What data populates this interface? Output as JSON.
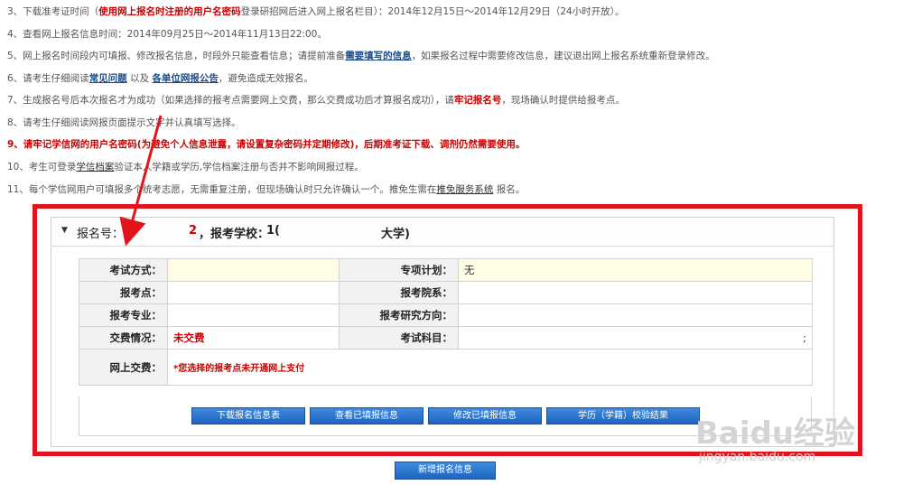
{
  "notes": {
    "n3": {
      "a": "3、下载准考证时间（",
      "b": "使用网上报名时注册的用户名密码",
      "c": "登录研招网后进入网上报名栏目）：2014年12月15日～2014年12月29日（24小时开放）。"
    },
    "n4": {
      "a": "4、查看网上报名信息时间：2014年09月25日～2014年11月13日22:00。"
    },
    "n5": {
      "a": "5、网上报名时间段内可填报、修改报名信息，时段外只能查看信息；请提前准备",
      "link": "需要填写的信息",
      "c": "，如果报名过程中需要修改信息，建议退出网上报名系统重新登录修改。"
    },
    "n6": {
      "a": "6、请考生仔细阅读",
      "link1": "常见问题",
      "b": "以及",
      "link2": "各单位网报公告",
      "c": "，避免造成无效报名。"
    },
    "n7": {
      "a": "7、生成报名号后本次报名才为成功（如果选择的报考点需要网上交费，那么交费成功后才算报名成功），请",
      "b": "牢记报名号",
      "c": "，现场确认时提供给报考点。"
    },
    "n8": {
      "a": "8、请考生仔细阅读网报页面提示文字并认真填写选择。"
    },
    "n9": {
      "a": "9、请牢记学信网的用户名密码(为避免个人信息泄露，请设置复杂密码并定期修改)，后期准考证下载、调剂仍然需要使用。"
    },
    "n10": {
      "a": "10、考生可登录",
      "u": "学信档案",
      "c": "验证本人学籍或学历,学信档案注册与否并不影响网报过程。"
    },
    "n11": {
      "a": "11、每个学信网用户可填报多个统考志愿，无需重复注册，但现场确认时只允许确认一个。推免生需在",
      "u": "推免服务系统",
      "c": "报名。"
    }
  },
  "panel": {
    "caret": "▼",
    "reg_label": "报名号：",
    "reg_num": "2",
    "school_label": "，报考学校：",
    "school_val": "1(",
    "school_tail": "大学)"
  },
  "table": {
    "row1": {
      "l1": "考试方式：",
      "v1": "",
      "l2": "专项计划：",
      "v2": "无"
    },
    "row2": {
      "l1": "报考点：",
      "v1": "",
      "l2": "报考院系：",
      "v2": ""
    },
    "row3": {
      "l1": "报考专业：",
      "v1": "",
      "l2": "报考研究方向：",
      "v2": ""
    },
    "row4": {
      "l1": "交费情况：",
      "v1": "未交费",
      "l2": "考试科目：",
      "v2": ";"
    },
    "row5": {
      "l1": "网上交费：",
      "v1": "*您选择的报考点未开通网上支付"
    }
  },
  "buttons": {
    "download": "下载报名信息表",
    "view": "查看已填报信息",
    "edit": "修改已填报信息",
    "verify": "学历（学籍）校验结果",
    "add": "新增报名信息"
  },
  "watermark": {
    "brand": "Baidu经验",
    "url": "jingyan.baidu.com"
  },
  "colors": {
    "highlight": "#e3131b",
    "button": "#2a74d2",
    "alert": "#cc0000"
  }
}
